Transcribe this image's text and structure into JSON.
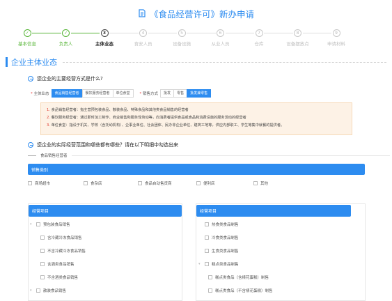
{
  "header": {
    "title": "《食品经营许可》新办申请"
  },
  "steps": [
    {
      "num": "✓",
      "label": "基本信息",
      "state": "done"
    },
    {
      "num": "✓",
      "label": "负责人",
      "state": "done"
    },
    {
      "num": "3",
      "label": "主体业态",
      "state": "active"
    },
    {
      "num": "4",
      "label": "食安人员",
      "state": "todo"
    },
    {
      "num": "5",
      "label": "设备设施",
      "state": "todo"
    },
    {
      "num": "6",
      "label": "从业人员",
      "state": "todo"
    },
    {
      "num": "7",
      "label": "仓库",
      "state": "todo"
    },
    {
      "num": "8",
      "label": "设备摆放点",
      "state": "todo"
    },
    {
      "num": "9",
      "label": "申请材料",
      "state": "todo"
    }
  ],
  "section": {
    "title": "企业主体业态"
  },
  "question1": {
    "text": "您企业的主要经营方式是什么?"
  },
  "form": {
    "body_label": "* 主体业态",
    "body_options": [
      "食品销售经营者",
      "餐饮服务经营者",
      "单位食堂"
    ],
    "body_selected": 0,
    "sales_label": "* 销售方式",
    "sales_options": [
      "批发",
      "零售",
      "批发兼零售"
    ],
    "sales_selected": 2
  },
  "notice": {
    "lines": [
      {
        "num": "1.",
        "text": "食品销售经营者：指主营预包装食品、散装食品、特殊食品和其他类食品销售的经营者"
      },
      {
        "num": "2.",
        "text": "餐饮服务经营者：通过即时加工制作、商业销售和服务性劳动等，向消费者提供食品或食品和消费设施的服务活动的经营者"
      },
      {
        "num": "3.",
        "text": "单位食堂：指设于机关、学校（含托幼机构）、企事业单位、社会团体、民办非企业单位、建筑工地等，供应内部职工、学生等集中就餐的提供者。"
      }
    ]
  },
  "question2": {
    "text": "您企业的实际经营范围和哪些都有哪些？请在以下明细中勾选出来"
  },
  "sub_label": "食品销售经营者",
  "sales_category": {
    "title": "销售类别",
    "items": [
      "商场超市",
      "食杂店",
      "食品自动售货商",
      "便利店",
      "其他"
    ]
  },
  "business_left": {
    "title": "经营项目",
    "items": [
      {
        "label": "预包装食品销售",
        "level": 0,
        "caret": "▾"
      },
      {
        "label": "含冷藏冷冻食品销售",
        "level": 1,
        "caret": ""
      },
      {
        "label": "不含冷藏冷冻食品销售",
        "level": 1,
        "caret": ""
      },
      {
        "label": "含酒类食品销售",
        "level": 1,
        "caret": ""
      },
      {
        "label": "不含酒类食品销售",
        "level": 1,
        "caret": ""
      },
      {
        "label": "散装食品销售",
        "level": 0,
        "caret": "▾"
      }
    ]
  },
  "business_right": {
    "title": "经营项目",
    "items": [
      {
        "label": "热食类食品制售",
        "level": 0,
        "caret": ""
      },
      {
        "label": "冷食类食品制售",
        "level": 0,
        "caret": ""
      },
      {
        "label": "生食类食品制售",
        "level": 0,
        "caret": ""
      },
      {
        "label": "糕点类食品制售",
        "level": 0,
        "caret": "▾"
      },
      {
        "label": "糕点类食品（含裱花蛋糕）制售",
        "level": 1,
        "caret": ""
      },
      {
        "label": "糕点类食品（不含裱花蛋糕）制售",
        "level": 1,
        "caret": ""
      }
    ]
  },
  "colors": {
    "accent": "#2d8cf0",
    "done": "#55b435",
    "notice_bg": "#fdf2e6",
    "notice_num": "#e03a2f"
  }
}
